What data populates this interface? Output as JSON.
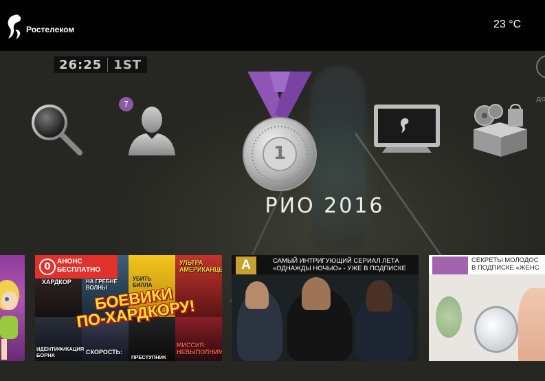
{
  "header": {
    "brand": "Ростелеком",
    "temperature": "23 °C"
  },
  "video": {
    "clock": "26:25",
    "period": "1ST"
  },
  "menu": {
    "items": [
      {
        "name": "search",
        "icon": "magnifier-icon"
      },
      {
        "name": "profile",
        "icon": "user-icon",
        "badge": "7"
      },
      {
        "name": "olympics",
        "icon": "medal-icon",
        "medal_number": "1",
        "title": "РИО 2016"
      },
      {
        "name": "tv",
        "icon": "tv-icon"
      },
      {
        "name": "store",
        "icon": "film-box-icon"
      }
    ]
  },
  "banners": {
    "action": {
      "promo_line1": "АНОНС",
      "promo_line2": "БЕСПЛАТНО",
      "promo_digit": "0",
      "headline_line1": "БОЕВИКИ",
      "headline_line2": "ПО-ХАРДКОРУ!",
      "tiles": [
        "ХАРДКОР",
        "НА ГРЕБНЕ ВОЛНЫ",
        "УБИТЬ БИЛЛА",
        "УЛЬТРА АМЕРИКАНЦЫ",
        "ИДЕНТИФИКАЦИЯ БОРНА",
        "СКОРОСТЬ:",
        "ПРЕСТУПНИК",
        "МИССИЯ: НЕВЫПОЛНИМА"
      ]
    },
    "series": {
      "logo_letter": "A",
      "line1": "САМЫЙ ИНТРИГУЮЩИЙ СЕРИАЛ ЛЕТА",
      "line2": "«ОДНАЖДЫ НОЧЬЮ» - УЖЕ В ПОДПИСКЕ"
    },
    "beauty": {
      "line1": "СЕКРЕТЫ МОЛОДОС",
      "line2": "В ПОДПИСКЕ «ЖЕНС"
    }
  },
  "colors": {
    "topbar": "#000000",
    "badge": "#8b5aa6",
    "medal_ribbon": "#8e55b5",
    "promo_red": "#e0322b",
    "headline_yellow": "#ffe22a"
  }
}
